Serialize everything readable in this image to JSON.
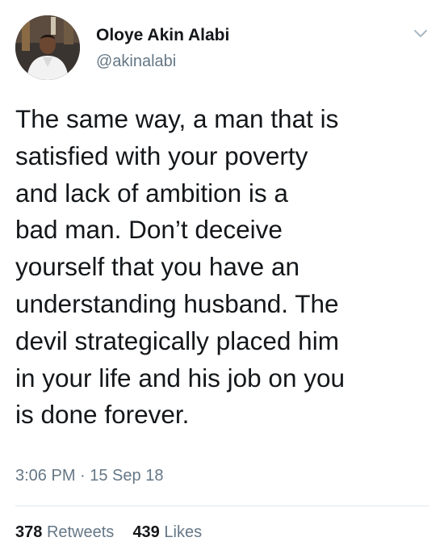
{
  "tweet": {
    "author": {
      "name": "Oloye Akin Alabi",
      "handle": "@akinalabi"
    },
    "text": "The same way, a man that is\nsatisfied with your poverty\nand lack of ambition is a\nbad man. Don’t deceive\nyourself that you have an\nunderstanding husband. The\ndevil strategically placed him\nin your life and his job on you\nis done forever.",
    "timestamp": "3:06 PM · 15 Sep 18",
    "stats": {
      "retweets_count": "378",
      "retweets_label": "Retweets",
      "likes_count": "439",
      "likes_label": "Likes"
    }
  },
  "icons": {
    "menu": "chevron-down-icon",
    "avatar": "profile-photo"
  },
  "colors": {
    "text": "#14171a",
    "secondary_text": "#657786",
    "divider": "#e1e8ed"
  }
}
